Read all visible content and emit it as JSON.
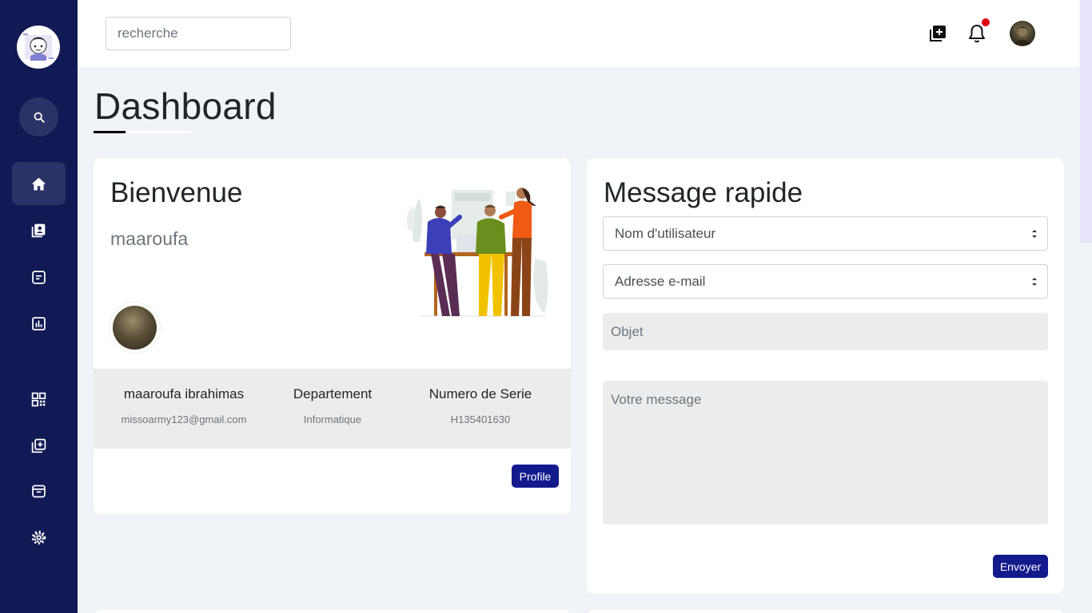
{
  "sidebar": {
    "items": [
      {
        "icon": "home-icon",
        "active": true
      },
      {
        "icon": "contact-book-icon",
        "active": false
      },
      {
        "icon": "document-icon",
        "active": false
      },
      {
        "icon": "bar-chart-icon",
        "active": false
      },
      {
        "icon": "qr-code-icon",
        "active": false
      },
      {
        "icon": "add-copy-icon",
        "active": false
      },
      {
        "icon": "archive-icon",
        "active": false
      },
      {
        "icon": "settings-icon",
        "active": false
      }
    ]
  },
  "topbar": {
    "search_placeholder": "recherche",
    "has_notification": true
  },
  "page": {
    "title": "Dashboard"
  },
  "welcome": {
    "title": "Bienvenue",
    "username": "maaroufa",
    "info": [
      {
        "main": "maaroufa ibrahimas",
        "sub": "missoarmy123@gmail.com"
      },
      {
        "main": "Departement",
        "sub": "Informatique"
      },
      {
        "main": "Numero de Serie",
        "sub": "H135401630"
      }
    ],
    "profile_button": "Profile"
  },
  "message": {
    "title": "Message rapide",
    "user_select": "Nom d'utilisateur",
    "email_select": "Adresse e-mail",
    "subject_placeholder": "Objet",
    "body_placeholder": "Votre message",
    "send_button": "Envoyer"
  },
  "colors": {
    "sidebar": "#121a55",
    "sidebar_active": "#2b3366",
    "primary_button": "#121a8c",
    "notification": "#e3000f",
    "background": "#f0f3f8"
  }
}
